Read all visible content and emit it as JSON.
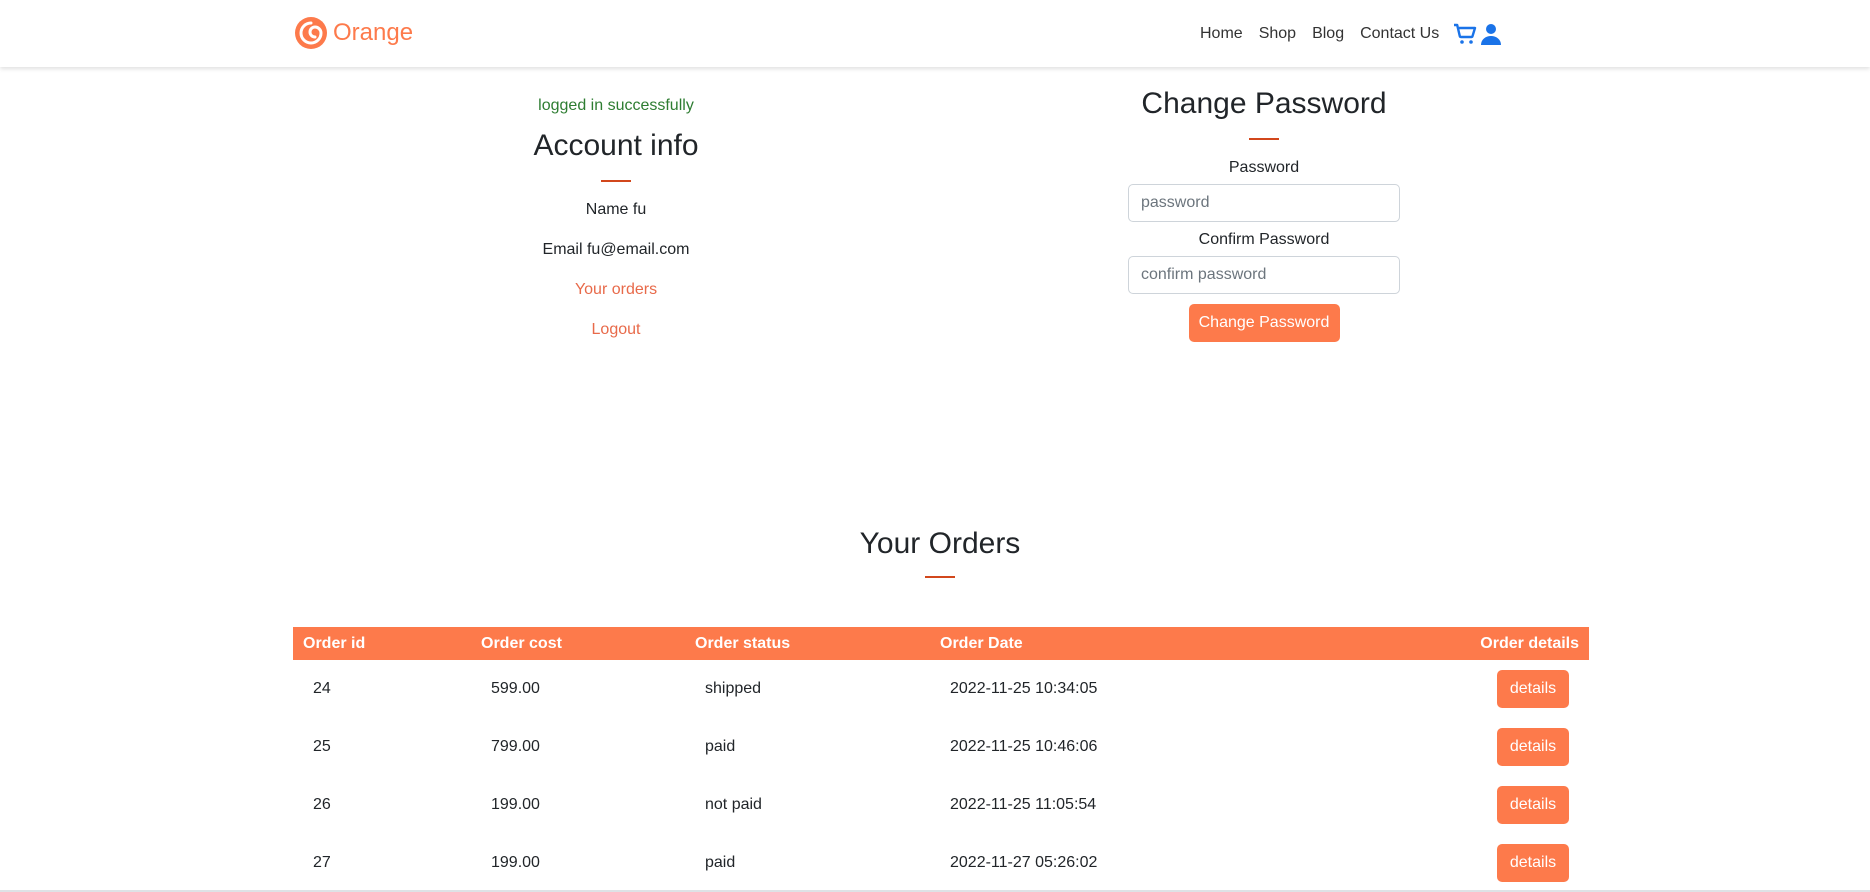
{
  "brand": {
    "name": "Orange",
    "color": "#fd7a4b"
  },
  "nav": {
    "items": [
      "Home",
      "Shop",
      "Blog",
      "Contact Us"
    ],
    "cart_icon": "cart-icon",
    "user_icon": "user-icon",
    "icon_color": "#1a73e8"
  },
  "account": {
    "status_message": "logged in successfully",
    "title": "Account info",
    "name_line": "Name fu",
    "email_line": "Email fu@email.com",
    "orders_link": "Your orders",
    "logout_link": "Logout"
  },
  "change_password": {
    "title": "Change Password",
    "password_label": "Password",
    "password_placeholder": "password",
    "confirm_label": "Confirm Password",
    "confirm_placeholder": "confirm password",
    "submit_label": "Change Password"
  },
  "orders": {
    "title": "Your Orders",
    "columns": [
      "Order id",
      "Order cost",
      "Order status",
      "Order Date",
      "Order details"
    ],
    "rows": [
      {
        "id": "24",
        "cost": "599.00",
        "status": "shipped",
        "date": "2022-11-25 10:34:05",
        "action": "details"
      },
      {
        "id": "25",
        "cost": "799.00",
        "status": "paid",
        "date": "2022-11-25 10:46:06",
        "action": "details"
      },
      {
        "id": "26",
        "cost": "199.00",
        "status": "not paid",
        "date": "2022-11-25 11:05:54",
        "action": "details"
      },
      {
        "id": "27",
        "cost": "199.00",
        "status": "paid",
        "date": "2022-11-27 05:26:02",
        "action": "details"
      }
    ]
  },
  "colors": {
    "accent": "#fd7a4b",
    "underline": "#d2471c",
    "success": "#2e7d32",
    "link": "#e86a4a"
  }
}
